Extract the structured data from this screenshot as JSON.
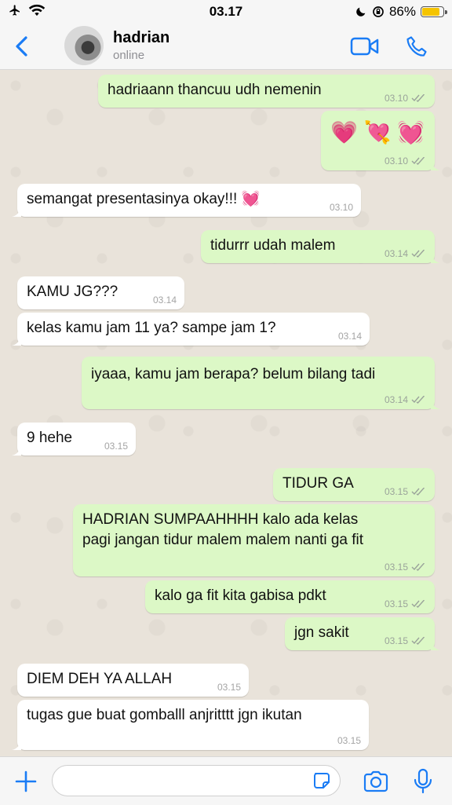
{
  "status_bar": {
    "time": "03.17",
    "battery": "86%",
    "battery_level": 0.86
  },
  "header": {
    "name": "hadrian",
    "status": "online"
  },
  "messages": [
    {
      "dir": "out",
      "text": "hadriaann thancuu udh nemenin",
      "time": "03.10"
    },
    {
      "dir": "out",
      "text": "💗 💘 💓",
      "time": "03.10"
    },
    {
      "dir": "in",
      "text": "semangat presentasinya okay!!! 💓",
      "time": "03.10"
    },
    {
      "dir": "out",
      "text": "tidurrr udah malem",
      "time": "03.14"
    },
    {
      "dir": "in",
      "text": "KAMU JG???",
      "time": "03.14"
    },
    {
      "dir": "in",
      "text": "kelas kamu jam 11 ya? sampe jam 1?",
      "time": "03.14"
    },
    {
      "dir": "out",
      "text": "iyaaa, kamu jam berapa? belum bilang tadi",
      "time": "03.14"
    },
    {
      "dir": "in",
      "text": "9 hehe",
      "time": "03.15"
    },
    {
      "dir": "out",
      "text": "TIDUR GA",
      "time": "03.15"
    },
    {
      "dir": "out",
      "text": "HADRIAN SUMPAAHHHH kalo ada kelas\npagi jangan tidur malem malem nanti ga fit",
      "time": "03.15"
    },
    {
      "dir": "out",
      "text": "kalo ga fit kita gabisa pdkt",
      "time": "03.15"
    },
    {
      "dir": "out",
      "text": "jgn sakit",
      "time": "03.15"
    },
    {
      "dir": "in",
      "text": "DIEM DEH YA ALLAH",
      "time": "03.15"
    },
    {
      "dir": "in",
      "text": "tugas gue buat gomballl anjritttt jgn ikutan",
      "time": "03.15"
    }
  ],
  "input": {
    "placeholder": "",
    "value": ""
  },
  "colors": {
    "accent": "#1a7cf5",
    "outgoing": "#dcf8c6",
    "incoming": "#ffffff"
  }
}
